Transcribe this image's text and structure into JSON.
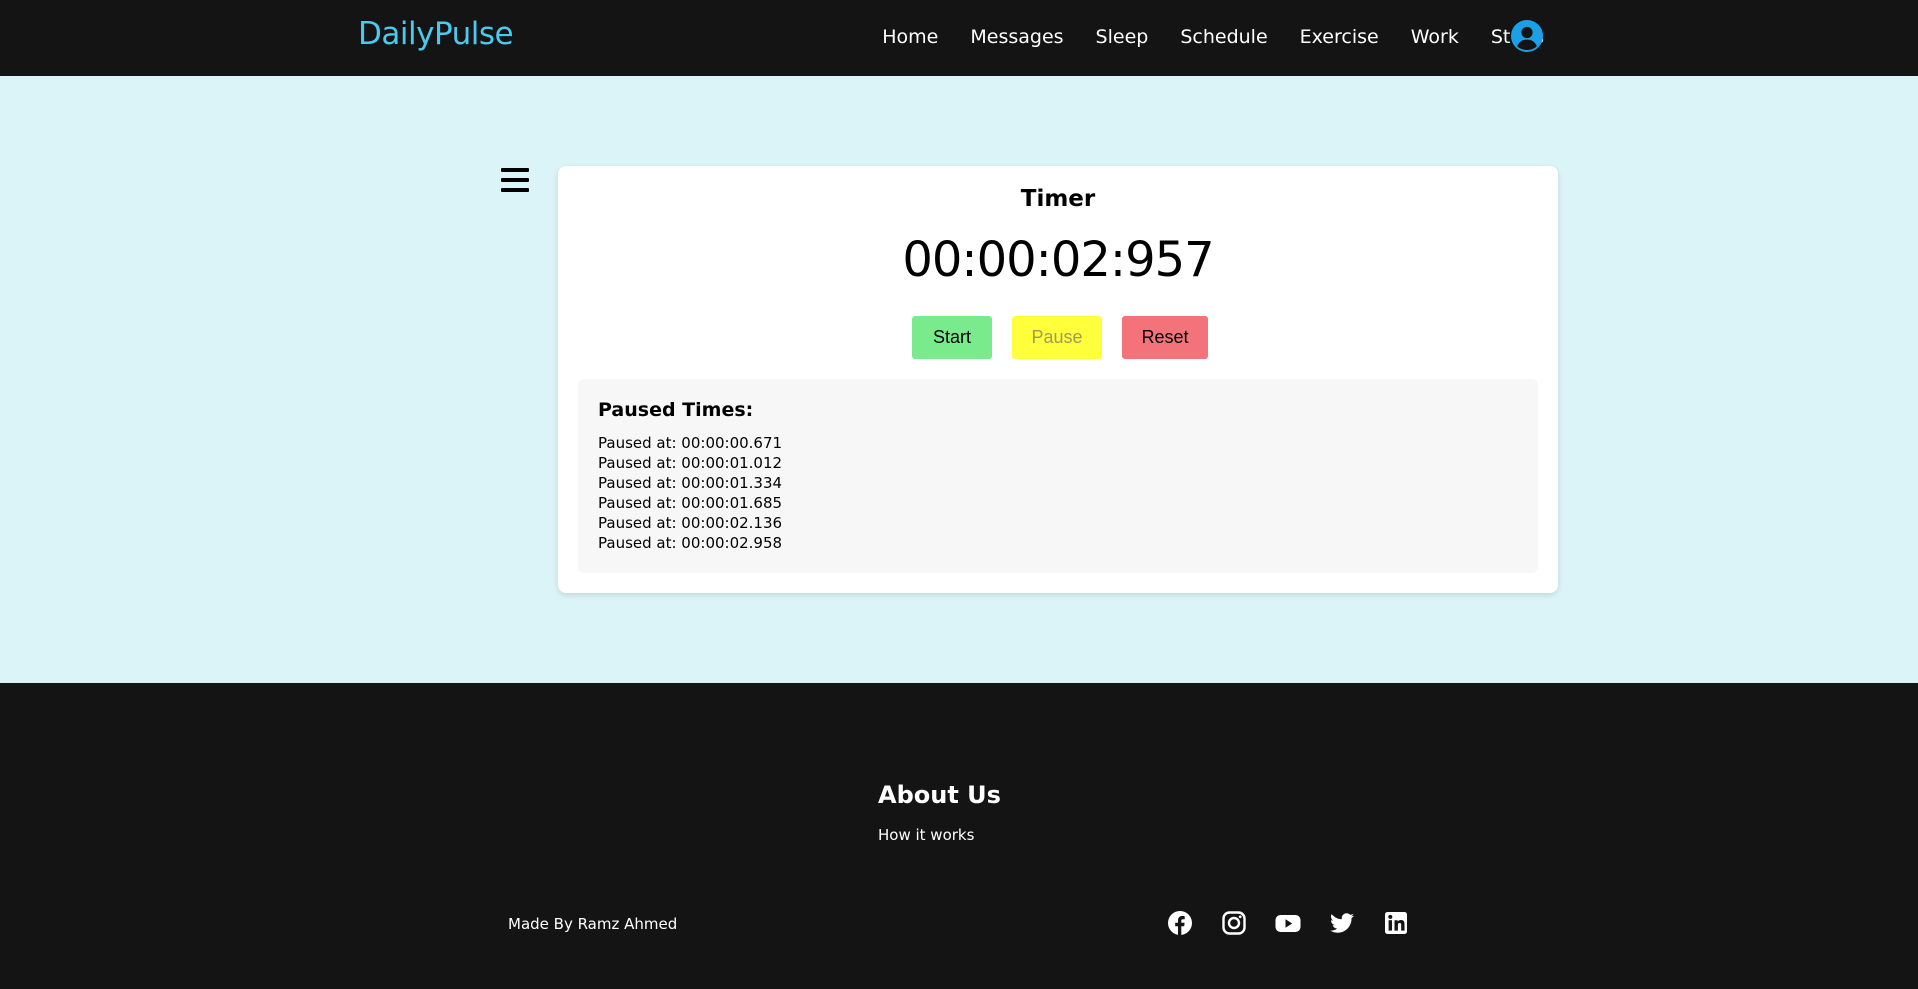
{
  "brand": "DailyPulse",
  "nav": {
    "items": [
      "Home",
      "Messages",
      "Sleep",
      "Schedule",
      "Exercise",
      "Work",
      "Steps"
    ]
  },
  "timer": {
    "title": "Timer",
    "display": "00:00:02:957",
    "start_label": "Start",
    "pause_label": "Pause",
    "reset_label": "Reset"
  },
  "paused": {
    "title": "Paused Times:",
    "entries": [
      "Paused at: 00:00:00.671",
      "Paused at: 00:00:01.012",
      "Paused at: 00:00:01.334",
      "Paused at: 00:00:01.685",
      "Paused at: 00:00:02.136",
      "Paused at: 00:00:02.958"
    ]
  },
  "footer": {
    "about_title": "About Us",
    "about_link": "How it works",
    "made_by": "Made By Ramz Ahmed",
    "socials": [
      "facebook-icon",
      "instagram-icon",
      "youtube-icon",
      "twitter-icon",
      "linkedin-icon"
    ]
  },
  "colors": {
    "brand": "#4cc9ef",
    "start": "#7aeb8c",
    "pause": "#ffff3c",
    "reset": "#f4727a",
    "page_bg": "#dbf4f7",
    "header_bg": "#141414"
  }
}
